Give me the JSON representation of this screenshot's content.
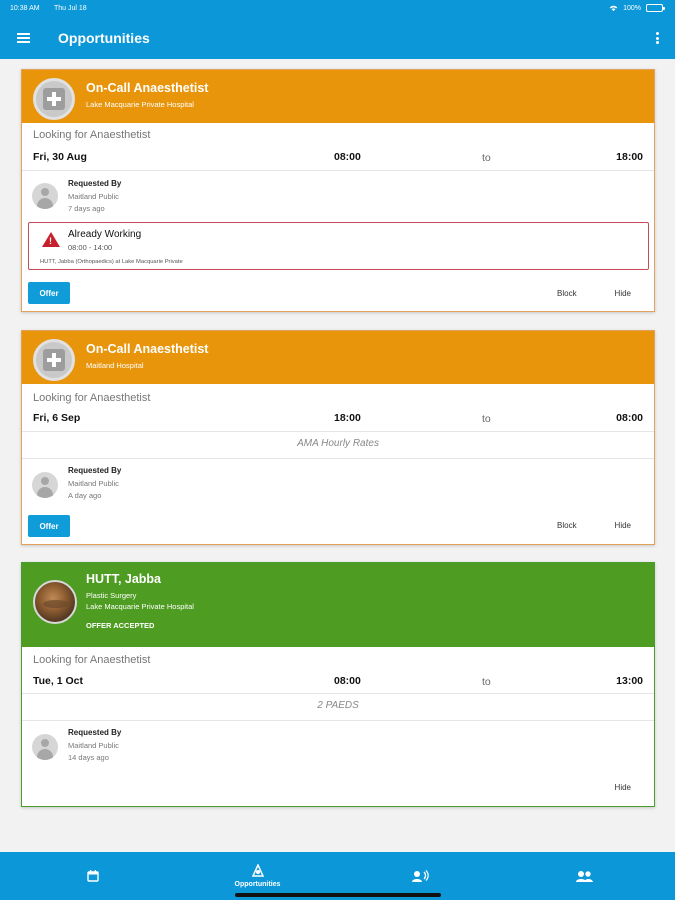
{
  "status_bar": {
    "time": "10:38 AM",
    "date": "Thu Jul 18",
    "battery": "100%",
    "icons": [
      "wifi-icon",
      "battery-icon"
    ]
  },
  "header": {
    "title": "Opportunities",
    "icons": {
      "menu": "menu-icon",
      "more": "more-vert-icon"
    }
  },
  "colors": {
    "header_blue": "#0c98d8",
    "card_orange": "#e8950c",
    "card_green": "#4f9c22",
    "warning_red": "#c5202b"
  },
  "cards": [
    {
      "title": "On-Call Anaesthetist",
      "hospital": "Lake Macquarie Private Hospital",
      "avatar_icon": "medical-plus-icon",
      "looking_for": "Looking for Anaesthetist",
      "date": "Fri, 30 Aug",
      "start": "08:00",
      "to": "to",
      "end": "18:00",
      "requested_by_label": "Requested By",
      "requested_by": "Maitland Public",
      "requested_ago": "7 days ago",
      "warning": {
        "icon": "warning-icon",
        "title": "Already Working",
        "time": "08:00 - 14:00",
        "detail": "HUTT, Jabba (Orthopaedics) at Lake Macquarie Private"
      },
      "actions": {
        "offer": "Offer",
        "block": "Block",
        "hide": "Hide"
      }
    },
    {
      "title": "On-Call Anaesthetist",
      "hospital": "Maitland Hospital",
      "avatar_icon": "medical-plus-icon",
      "looking_for": "Looking for Anaesthetist",
      "date": "Fri, 6 Sep",
      "start": "18:00",
      "to": "to",
      "end": "08:00",
      "rate_note": "AMA Hourly Rates",
      "requested_by_label": "Requested By",
      "requested_by": "Maitland Public",
      "requested_ago": "A day ago",
      "actions": {
        "offer": "Offer",
        "block": "Block",
        "hide": "Hide"
      }
    },
    {
      "title": "HUTT, Jabba",
      "specialty": "Plastic Surgery",
      "hospital": "Lake Macquarie Private Hospital",
      "status": "OFFER ACCEPTED",
      "avatar_icon": "profile-photo",
      "looking_for": "Looking for Anaesthetist",
      "date": "Tue, 1 Oct",
      "start": "08:00",
      "to": "to",
      "end": "13:00",
      "rate_note": "2 PAEDS",
      "requested_by_label": "Requested By",
      "requested_by": "Maitland Public",
      "requested_ago": "14 days ago",
      "actions": {
        "hide": "Hide"
      }
    }
  ],
  "bottom_nav": {
    "items": [
      {
        "icon": "calendar-icon",
        "label": ""
      },
      {
        "icon": "opportunities-icon",
        "label": "Opportunities",
        "active": true
      },
      {
        "icon": "voice-person-icon",
        "label": ""
      },
      {
        "icon": "people-icon",
        "label": ""
      }
    ]
  }
}
